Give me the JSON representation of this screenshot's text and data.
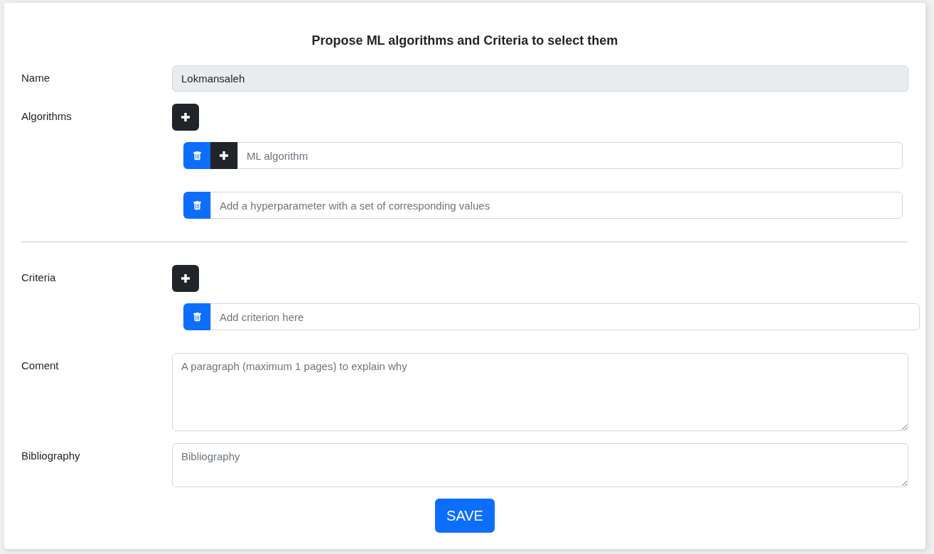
{
  "title": "Propose ML algorithms and Criteria to select them",
  "name_field": {
    "label": "Name",
    "value": "Lokmansaleh",
    "disabled": true
  },
  "algorithms": {
    "label": "Algorithms",
    "items": [
      {
        "placeholder": "ML algorithm",
        "hyperparameters": [
          {
            "placeholder": "Add a hyperparameter with a set of corresponding values"
          }
        ]
      }
    ]
  },
  "criteria": {
    "label": "Criteria",
    "items": [
      {
        "placeholder": "Add criterion here"
      }
    ]
  },
  "comment": {
    "label": "Coment",
    "placeholder": "A paragraph (maximum 1 pages) to explain why"
  },
  "bibliography": {
    "label": "Bibliography",
    "placeholder": "Bibliography"
  },
  "save_button": "SAVE"
}
